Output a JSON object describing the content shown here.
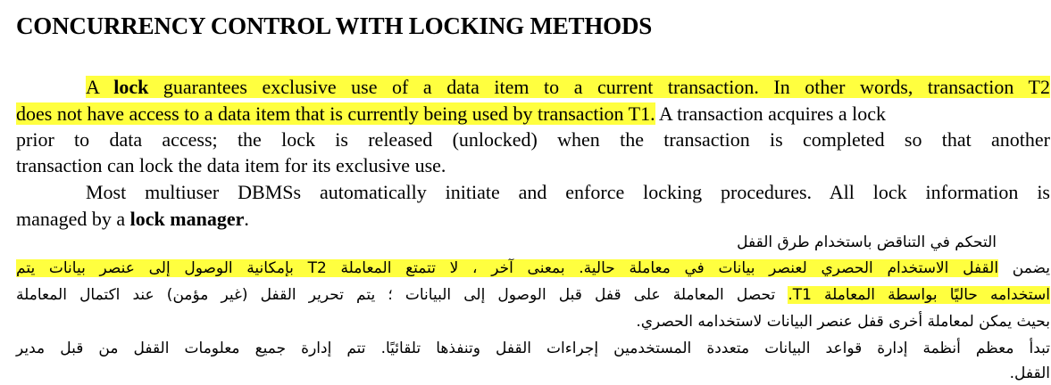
{
  "heading": "CONCURRENCY CONTROL WITH LOCKING METHODS",
  "english": {
    "p1": {
      "indent": "A ",
      "bold_lock": "lock",
      "line1_rest": " guarantees exclusive use of a data item to a current transaction. In other words, transaction T2",
      "line2_highlight": "does not have access to a data item that is currently being used by transaction T1.",
      "line2_rest": " A transaction acquires a lock",
      "line3": "prior to data access; the lock is released (unlocked) when the transaction is completed so that another",
      "line4": "transaction can lock the data item for its exclusive use."
    },
    "p2": {
      "line1": "Most multiuser DBMSs automatically initiate and enforce locking procedures. All lock information is",
      "line2_pre": "managed by a ",
      "line2_bold": "lock manager",
      "line2_post": "."
    }
  },
  "arabic": {
    "title": "التحكم في التناقض باستخدام طرق القفل",
    "p1": {
      "line1_pre": "يضمن ",
      "line1_highlight": "القفل الاستخدام الحصري لعنصر بيانات في معاملة حالية. بمعنى آخر ، لا تتمتع المعاملة T2 بإمكانية الوصول إلى عنصر بيانات يتم",
      "line2_highlight": "استخدامه حاليًا بواسطة المعاملة T1.",
      "line2_rest": " تحصل المعاملة على قفل قبل الوصول إلى البيانات ؛ يتم تحرير القفل (غير مؤمن) عند اكتمال المعاملة",
      "line3": "بحيث يمكن لمعاملة أخرى قفل عنصر البيانات لاستخدامه الحصري."
    },
    "p2": {
      "line1": "تبدأ معظم أنظمة إدارة قواعد البيانات متعددة المستخدمين إجراءات القفل وتنفذها تلقائيًا. تتم إدارة جميع معلومات القفل من قبل مدير",
      "line2": "القفل."
    }
  },
  "colors": {
    "highlight": "#ffff3f",
    "text": "#000000",
    "background": "#ffffff"
  }
}
